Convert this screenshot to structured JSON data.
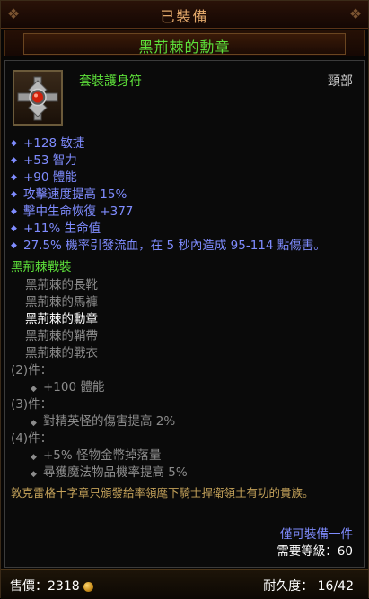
{
  "header": {
    "status": "已裝備",
    "item_name": "黑荊棘的勳章",
    "corner_left": "❖",
    "corner_right": "❖"
  },
  "item": {
    "type": "套裝護身符",
    "slot": "頸部",
    "icon": "amulet-icon",
    "properties": [
      "+128 敏捷",
      "+53 智力",
      "+90 體能",
      "攻擊速度提高 15%",
      "擊中生命恢復 +377",
      "+11% 生命值",
      "27.5% 機率引發流血，在 5 秒內造成 95-114 點傷害。"
    ]
  },
  "set": {
    "title": "黑荊棘戰裝",
    "items": [
      {
        "label": "黑荊棘的長靴",
        "current": false
      },
      {
        "label": "黑荊棘的馬褲",
        "current": false
      },
      {
        "label": "黑荊棘的勳章",
        "current": true
      },
      {
        "label": "黑荊棘的鞘帶",
        "current": false
      },
      {
        "label": "黑荊棘的戰衣",
        "current": false
      }
    ],
    "bonuses": [
      {
        "pieces": "(2)件：",
        "lines": [
          "+100 體能"
        ]
      },
      {
        "pieces": "(3)件：",
        "lines": [
          "對精英怪的傷害提高 2%"
        ]
      },
      {
        "pieces": "(4)件：",
        "lines": [
          "+5% 怪物金幣掉落量",
          "尋獲魔法物品機率提高 5%"
        ]
      }
    ]
  },
  "flavor": "敦克雷格十字章只頒發給率領麾下騎士捍衛領土有功的貴族。",
  "restriction": "僅可裝備一件",
  "level_req": "需要等級：60",
  "footer": {
    "price_label": "售價：2318",
    "durability_label": "耐久度：",
    "durability_value": "16/42"
  },
  "colors": {
    "set_green": "#5de03a",
    "magic_blue": "#7f8cff",
    "flavor_gold": "#c4a25a",
    "inactive_gray": "#8c8c8c"
  }
}
